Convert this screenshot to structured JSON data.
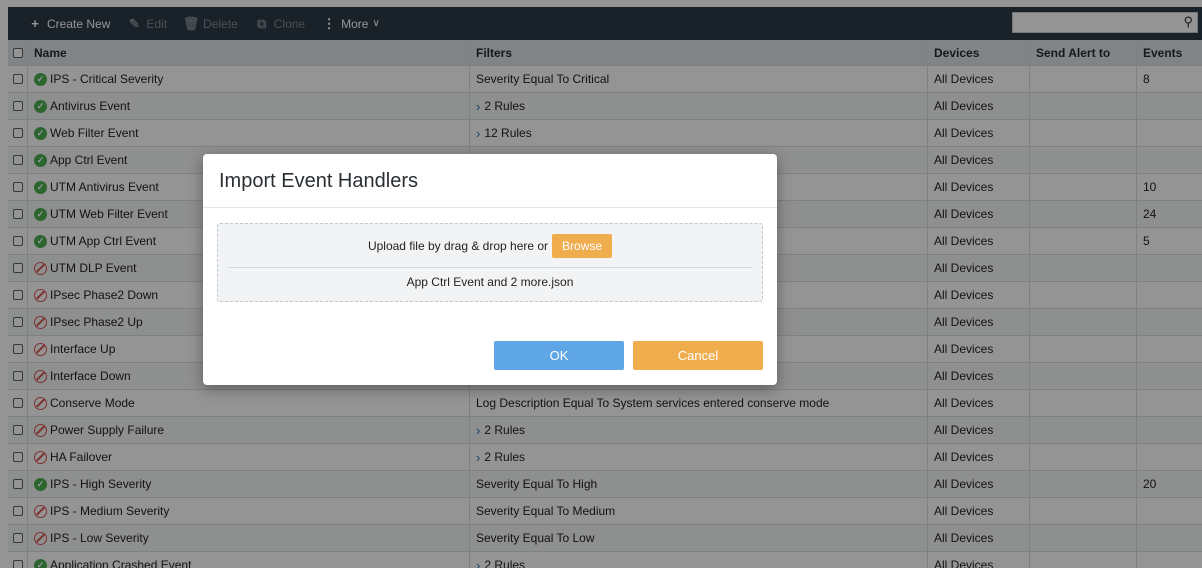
{
  "toolbar": {
    "create_new": "Create New",
    "edit": "Edit",
    "delete": "Delete",
    "clone": "Clone",
    "more": "More",
    "search_placeholder": ""
  },
  "table": {
    "headers": {
      "name": "Name",
      "filters": "Filters",
      "devices": "Devices",
      "send_alert_to": "Send Alert to",
      "events": "Events"
    },
    "rows": [
      {
        "status": "enabled",
        "name": "IPS - Critical Severity",
        "filters": "Severity Equal To Critical",
        "expandable": false,
        "devices": "All Devices",
        "alert": "",
        "events": "8"
      },
      {
        "status": "enabled",
        "name": "Antivirus Event",
        "filters": "2 Rules",
        "expandable": true,
        "devices": "All Devices",
        "alert": "",
        "events": ""
      },
      {
        "status": "enabled",
        "name": "Web Filter Event",
        "filters": "12 Rules",
        "expandable": true,
        "devices": "All Devices",
        "alert": "",
        "events": ""
      },
      {
        "status": "enabled",
        "name": "App Ctrl Event",
        "filters": "",
        "expandable": false,
        "devices": "All Devices",
        "alert": "",
        "events": ""
      },
      {
        "status": "enabled",
        "name": "UTM Antivirus Event",
        "filters": "",
        "expandable": false,
        "devices": "All Devices",
        "alert": "",
        "events": "10"
      },
      {
        "status": "enabled",
        "name": "UTM Web Filter Event",
        "filters": "",
        "expandable": false,
        "devices": "All Devices",
        "alert": "",
        "events": "24"
      },
      {
        "status": "enabled",
        "name": "UTM App Ctrl Event",
        "filters": "",
        "expandable": false,
        "devices": "All Devices",
        "alert": "",
        "events": "5"
      },
      {
        "status": "disabled",
        "name": "UTM DLP Event",
        "filters": "",
        "expandable": false,
        "devices": "All Devices",
        "alert": "",
        "events": ""
      },
      {
        "status": "disabled",
        "name": "IPsec Phase2 Down",
        "filters": "",
        "expandable": false,
        "devices": "All Devices",
        "alert": "",
        "events": ""
      },
      {
        "status": "disabled",
        "name": "IPsec Phase2 Up",
        "filters": "",
        "expandable": false,
        "devices": "All Devices",
        "alert": "",
        "events": ""
      },
      {
        "status": "disabled",
        "name": "Interface Up",
        "filters": "",
        "expandable": false,
        "devices": "All Devices",
        "alert": "",
        "events": ""
      },
      {
        "status": "disabled",
        "name": "Interface Down",
        "filters": "",
        "expandable": false,
        "devices": "All Devices",
        "alert": "",
        "events": ""
      },
      {
        "status": "disabled",
        "name": "Conserve Mode",
        "filters": "Log Description Equal To System services entered conserve mode",
        "expandable": false,
        "devices": "All Devices",
        "alert": "",
        "events": ""
      },
      {
        "status": "disabled",
        "name": "Power Supply Failure",
        "filters": "2 Rules",
        "expandable": true,
        "devices": "All Devices",
        "alert": "",
        "events": ""
      },
      {
        "status": "disabled",
        "name": "HA Failover",
        "filters": "2 Rules",
        "expandable": true,
        "devices": "All Devices",
        "alert": "",
        "events": ""
      },
      {
        "status": "enabled",
        "name": "IPS - High Severity",
        "filters": "Severity Equal To High",
        "expandable": false,
        "devices": "All Devices",
        "alert": "",
        "events": "20"
      },
      {
        "status": "disabled",
        "name": "IPS - Medium Severity",
        "filters": "Severity Equal To Medium",
        "expandable": false,
        "devices": "All Devices",
        "alert": "",
        "events": ""
      },
      {
        "status": "disabled",
        "name": "IPS - Low Severity",
        "filters": "Severity Equal To Low",
        "expandable": false,
        "devices": "All Devices",
        "alert": "",
        "events": ""
      },
      {
        "status": "enabled",
        "name": "Application Crashed Event",
        "filters": "2 Rules",
        "expandable": true,
        "devices": "All Devices",
        "alert": "",
        "events": ""
      }
    ]
  },
  "modal": {
    "title": "Import Event Handlers",
    "upload_text": "Upload file by drag & drop here or",
    "browse_label": "Browse",
    "file_name": "App Ctrl Event and 2 more.json",
    "ok_label": "OK",
    "cancel_label": "Cancel"
  },
  "icons": {
    "create": "plus-icon",
    "edit": "edit-icon",
    "delete": "trash-icon",
    "clone": "clone-icon",
    "more": "kebab-icon",
    "search": "search-icon",
    "enabled": "check-circle-icon",
    "disabled": "prohibited-icon",
    "expand": "chevron-right-icon"
  },
  "colors": {
    "toolbar_bg": "#2d3b48",
    "enabled_status": "#4caf50",
    "disabled_status": "#d9534f",
    "browse_button": "#f0ad4e",
    "ok_button": "#5ea6e6",
    "cancel_button": "#f0ad4e"
  }
}
